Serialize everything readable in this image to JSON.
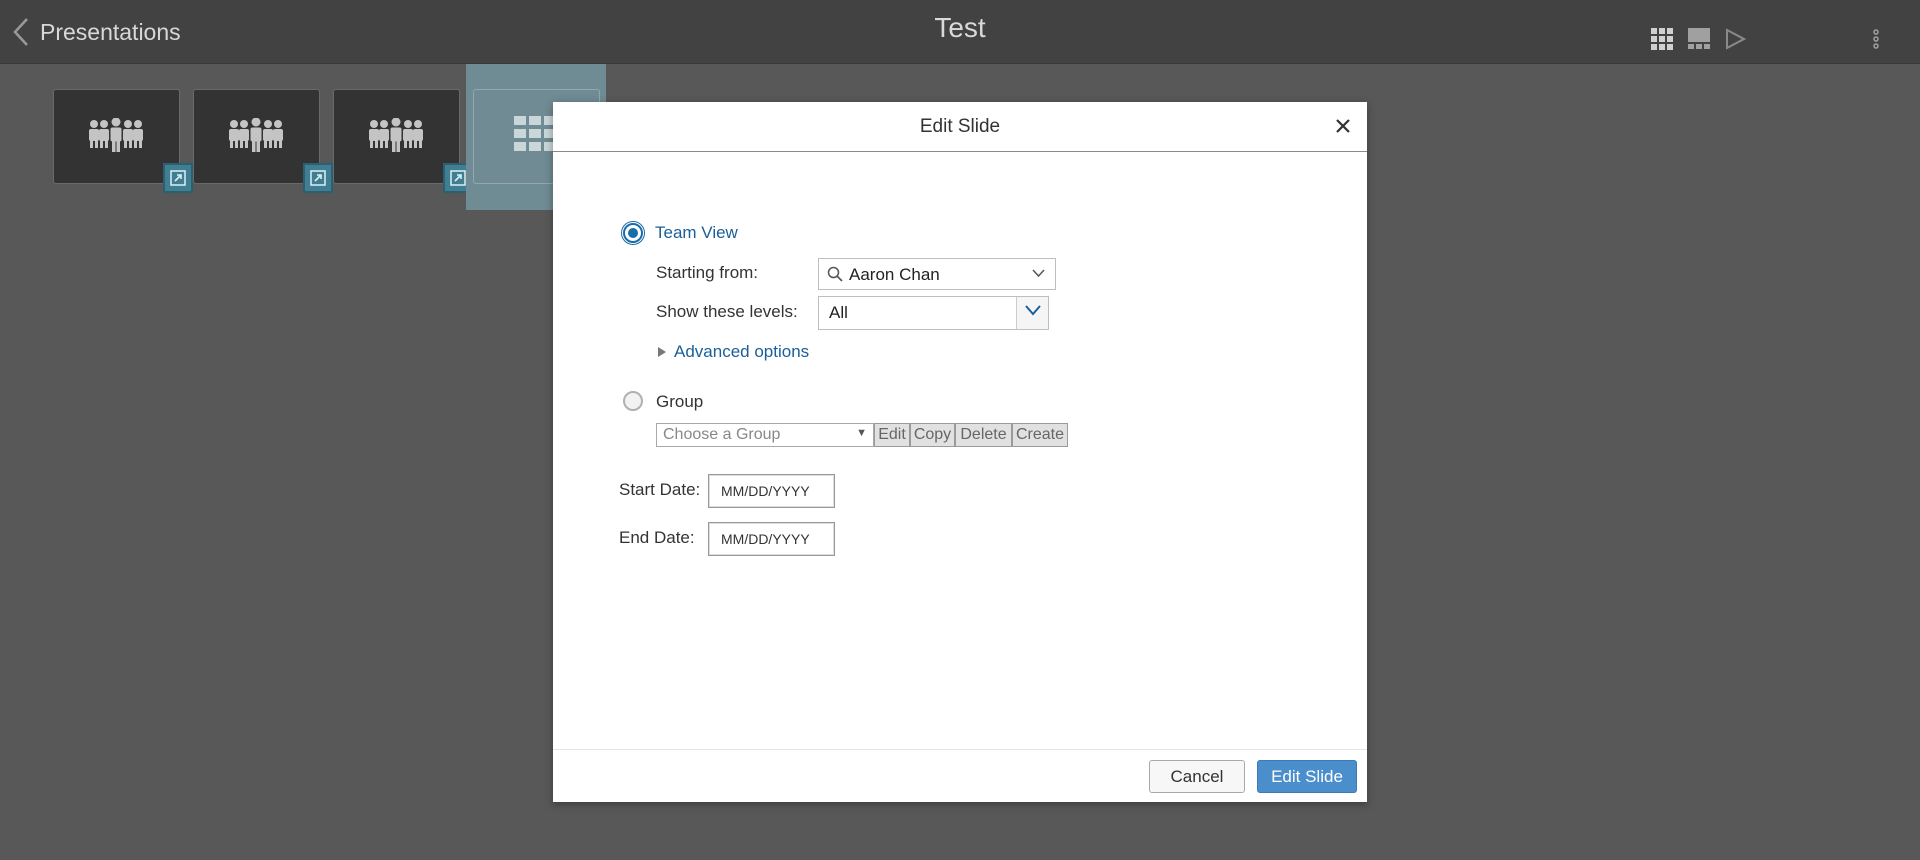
{
  "topbar": {
    "back_label": "Presentations",
    "title": "Test",
    "icons": [
      "grid-view-icon",
      "slide-view-icon",
      "play-icon",
      "more-options-icon"
    ]
  },
  "thumbnails": [
    {
      "type": "org-chart",
      "icon": "people-icon",
      "badge_icon": "external-link-icon"
    },
    {
      "type": "org-chart",
      "icon": "people-icon",
      "badge_icon": "external-link-icon"
    },
    {
      "type": "org-chart",
      "icon": "people-icon",
      "badge_icon": "external-link-icon"
    },
    {
      "type": "grid",
      "icon": "grid-icon",
      "selected": true
    }
  ],
  "dialog": {
    "title": "Edit Slide",
    "team_view_label": "Team View",
    "team_view_selected": true,
    "starting_from_label": "Starting from:",
    "starting_from_value": "Aaron Chan",
    "levels_label": "Show these levels:",
    "levels_value": "All",
    "advanced_options_label": "Advanced options",
    "group_label": "Group",
    "group_selected": false,
    "group_placeholder": "Choose a Group",
    "group_buttons": {
      "edit": "Edit",
      "copy": "Copy",
      "delete": "Delete",
      "create": "Create"
    },
    "start_date_label": "Start Date:",
    "start_date_placeholder": "MM/DD/YYYY",
    "end_date_label": "End Date:",
    "end_date_placeholder": "MM/DD/YYYY",
    "cancel_label": "Cancel",
    "submit_label": "Edit Slide"
  },
  "colors": {
    "background": "#585858",
    "topbar": "#424242",
    "accent": "#4a8ecc",
    "link": "#1a5f99",
    "badge": "#3f7f94"
  }
}
